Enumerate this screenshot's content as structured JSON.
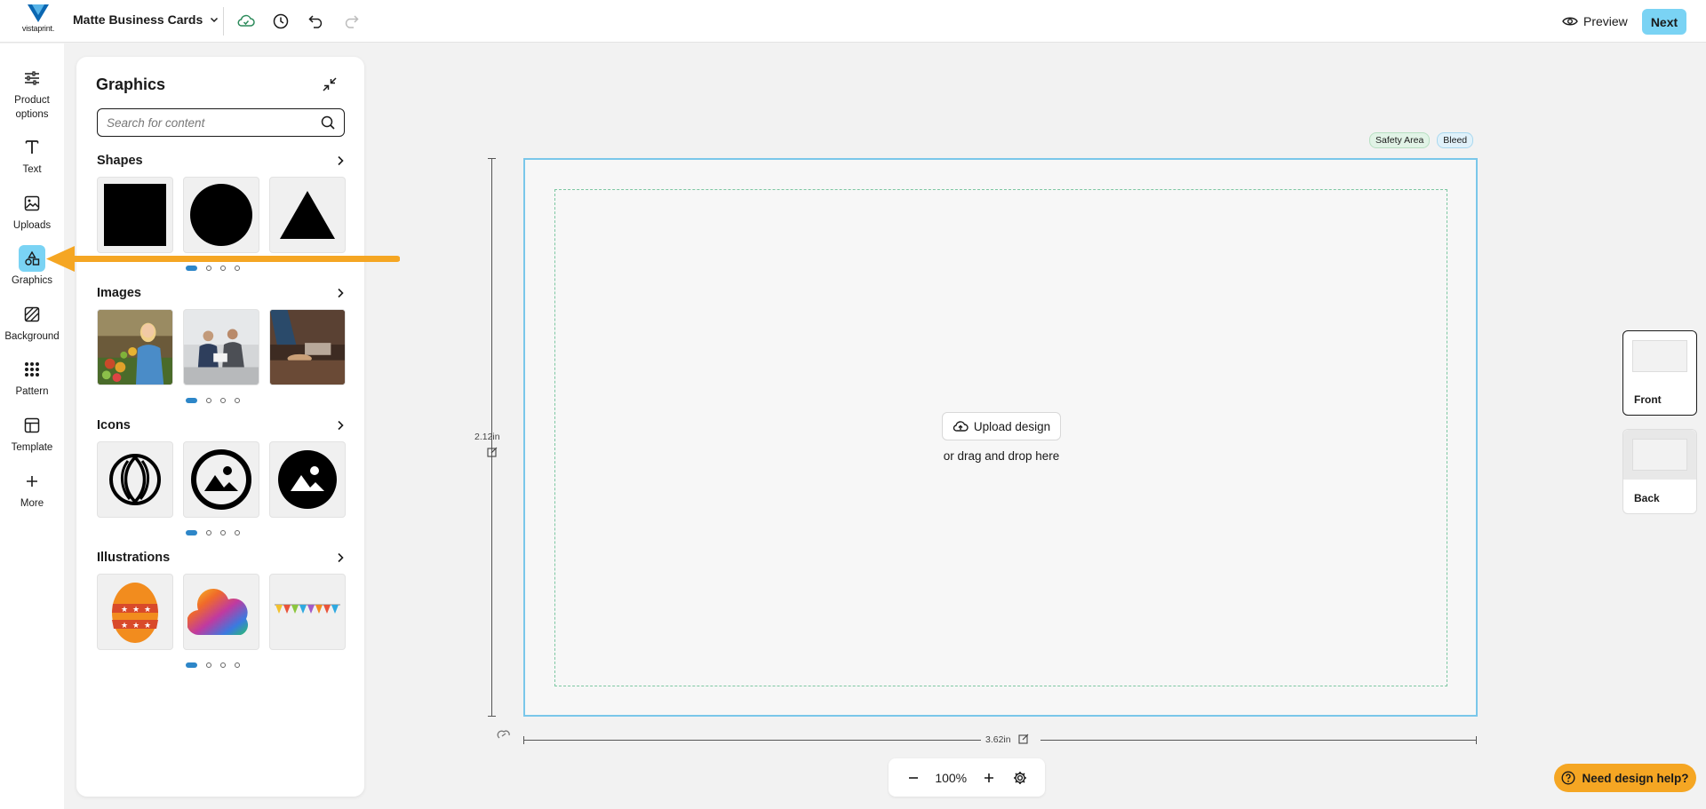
{
  "app": {
    "logo_text": "vistaprint.",
    "product_title": "Matte Business Cards"
  },
  "toolbar": {
    "save_icon": "cloud-check-icon",
    "history_icon": "clock-icon",
    "undo_icon": "undo-icon",
    "redo_icon": "redo-icon",
    "preview_label": "Preview",
    "next_label": "Next"
  },
  "rail": {
    "items": [
      {
        "label": "Product options",
        "icon": "sliders-icon"
      },
      {
        "label": "Text",
        "icon": "text-icon"
      },
      {
        "label": "Uploads",
        "icon": "image-icon"
      },
      {
        "label": "Graphics",
        "icon": "shapes-icon",
        "active": true
      },
      {
        "label": "Background",
        "icon": "background-icon"
      },
      {
        "label": "Pattern",
        "icon": "pattern-icon"
      },
      {
        "label": "Template",
        "icon": "template-icon"
      },
      {
        "label": "More",
        "icon": "plus-icon"
      }
    ]
  },
  "panel": {
    "title": "Graphics",
    "search_placeholder": "Search for content",
    "sections": [
      {
        "title": "Shapes",
        "items": [
          "square",
          "circle",
          "triangle"
        ]
      },
      {
        "title": "Images",
        "items": [
          "grocery-shopper",
          "business-meeting",
          "workbench"
        ]
      },
      {
        "title": "Icons",
        "items": [
          "leaf-circle-icon",
          "image-circle-outline-icon",
          "image-circle-filled-icon"
        ]
      },
      {
        "title": "Illustrations",
        "items": [
          "easter-egg",
          "rainbow-cloud",
          "bunting-banner"
        ]
      }
    ]
  },
  "canvas": {
    "badge_safety": "Safety Area",
    "badge_bleed": "Bleed",
    "upload_label": "Upload design",
    "drop_text": "or drag and drop here",
    "height_label": "2.12in",
    "width_label": "3.62in"
  },
  "zoom": {
    "value": "100%"
  },
  "sides": {
    "front_label": "Front",
    "back_label": "Back"
  },
  "help": {
    "label": "Need design help?"
  },
  "colors": {
    "accent": "#7ad3f4",
    "help": "#f5a623",
    "arrow": "#f5a623",
    "bleed_border": "#7ac7ea",
    "safety_border": "#7cc7a2"
  }
}
